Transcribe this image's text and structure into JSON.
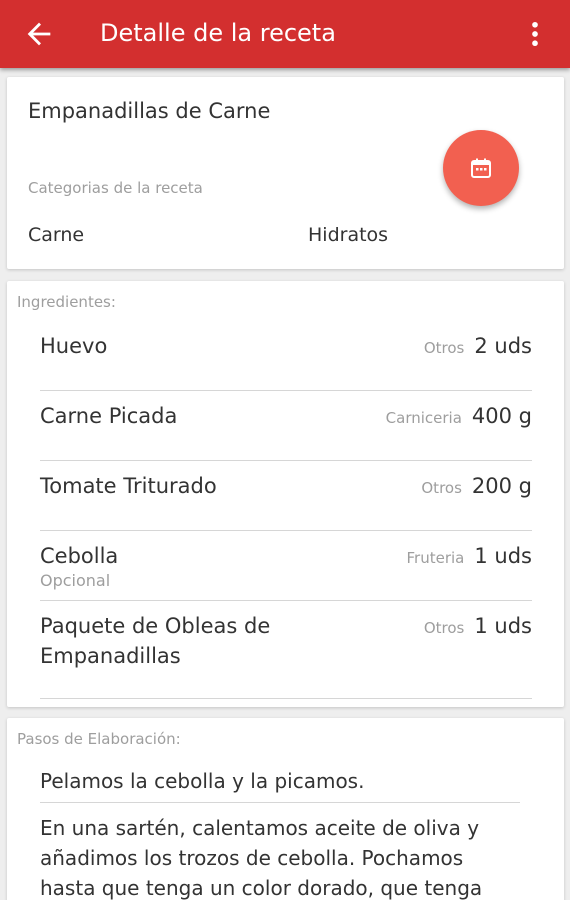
{
  "appbar": {
    "title": "Detalle de la receta",
    "back_icon": "arrow-back-icon",
    "menu_icon": "more-vert-icon",
    "color": "#d32f2f"
  },
  "recipe": {
    "name": "Empanadillas de Carne",
    "categories_label": "Categorias de la receta",
    "categories": [
      "Carne",
      "Hidratos"
    ],
    "fab_icon": "calendar-icon",
    "fab_color": "#f26050"
  },
  "ingredients": {
    "label": "Ingredientes:",
    "items": [
      {
        "name": "Huevo",
        "note": "",
        "category": "Otros",
        "quantity": "2 uds"
      },
      {
        "name": "Carne Picada",
        "note": "",
        "category": "Carniceria",
        "quantity": "400 g"
      },
      {
        "name": "Tomate Triturado",
        "note": "",
        "category": "Otros",
        "quantity": "200 g"
      },
      {
        "name": "Cebolla",
        "note": "Opcional",
        "category": "Fruteria",
        "quantity": "1 uds"
      },
      {
        "name": "Paquete de Obleas de Empanadillas",
        "note": "",
        "category": "Otros",
        "quantity": "1 uds"
      }
    ]
  },
  "steps": {
    "label": "Pasos de Elaboración:",
    "items": [
      "Pelamos la cebolla y la picamos.",
      "En una sartén, calentamos aceite de oliva y añadimos los trozos de cebolla. Pochamos hasta que tenga un color dorado, que tenga"
    ]
  }
}
